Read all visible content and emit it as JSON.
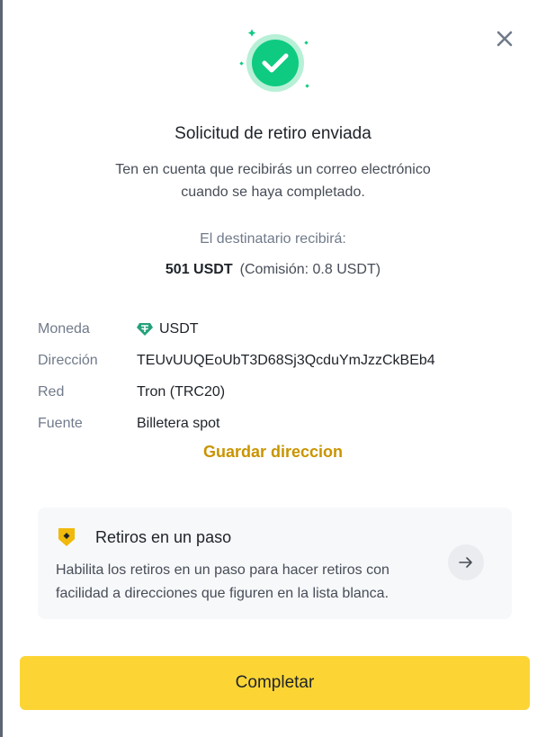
{
  "dialog": {
    "title": "Solicitud de retiro enviada",
    "description": "Ten en cuenta que recibirás un correo electrónico cuando se haya completado.",
    "receive_label": "El destinatario recibirá:",
    "amount": "501 USDT",
    "fee": "(Comisión: 0.8 USDT)"
  },
  "details": [
    {
      "key": "Moneda",
      "value": "USDT",
      "icon": "tether-icon"
    },
    {
      "key": "Dirección",
      "value": "TEUvUUQEoUbT3D68Sj3QcduYmJzzCkBEb4"
    },
    {
      "key": "Red",
      "value": "Tron (TRC20)"
    },
    {
      "key": "Fuente",
      "value": "Billetera spot"
    }
  ],
  "save_address_label": "Guardar direccion",
  "one_step_card": {
    "title": "Retiros en un paso",
    "description": "Habilita los retiros en un paso para hacer retiros con facilidad a direcciones que figuren en la lista blanca.",
    "icon": "shield-badge-icon"
  },
  "primary_button_label": "Completar",
  "colors": {
    "accent_yellow": "#fcd535",
    "link_gold": "#c99400",
    "success_green": "#0ecb81",
    "tether_green": "#26a17b"
  }
}
